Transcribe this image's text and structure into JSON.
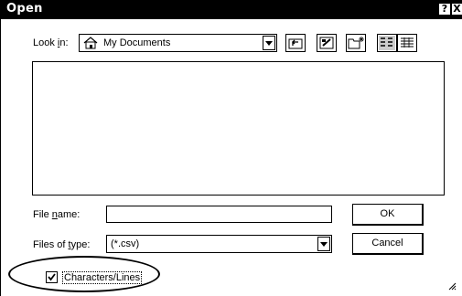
{
  "dialog": {
    "title": "Open",
    "help_label": "?",
    "close_label": "X"
  },
  "look_in": {
    "label_pre": "Look ",
    "label_key": "i",
    "label_post": "n:",
    "value": "My Documents",
    "folder_icon": "home-folder-icon"
  },
  "toolbar": {
    "buttons": [
      "up-one-level-icon",
      "desktop-icon",
      "new-folder-icon",
      "list-view-icon",
      "details-view-icon"
    ]
  },
  "file_name": {
    "label_pre": "File ",
    "label_key": "n",
    "label_post": "ame:",
    "value": ""
  },
  "files_of_type": {
    "label_pre": "Files of ",
    "label_key": "t",
    "label_post": "ype:",
    "value": "(*.csv)"
  },
  "buttons": {
    "ok_label": "OK",
    "cancel_label": "Cancel"
  },
  "options": {
    "characters_lines_label": "Characters/Lines",
    "characters_lines_checked": true
  }
}
